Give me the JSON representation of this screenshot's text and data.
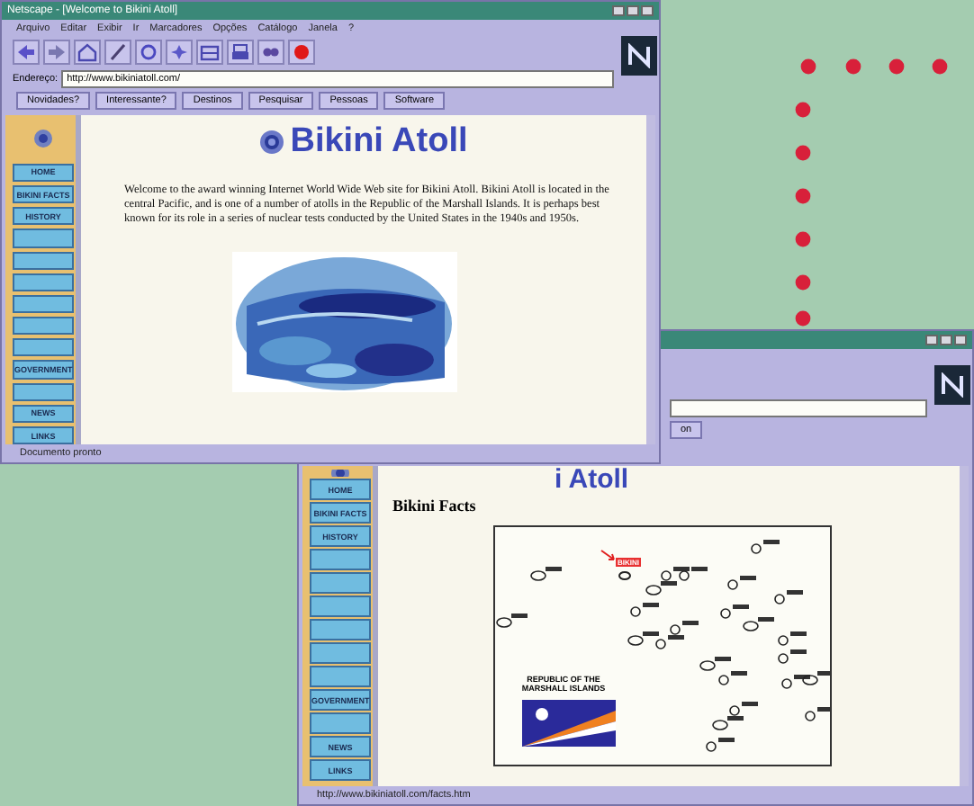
{
  "front_window": {
    "title": "Netscape - [Welcome to Bikini Atoll]",
    "menu": [
      "Arquivo",
      "Editar",
      "Exibir",
      "Ir",
      "Marcadores",
      "Opções",
      "Catálogo",
      "Janela",
      "?"
    ],
    "toolbar_buttons": [
      {
        "kind": "back"
      },
      {
        "kind": "forward"
      },
      {
        "kind": "home"
      },
      {
        "kind": "edit"
      },
      {
        "kind": "reload"
      },
      {
        "kind": "images"
      },
      {
        "kind": "open"
      },
      {
        "kind": "print"
      },
      {
        "kind": "find"
      },
      {
        "kind": "stop"
      }
    ],
    "address_label": "Endereço:",
    "address": "http://www.bikiniatoll.com/",
    "directory_buttons": [
      "Novidades?",
      "Interessante?",
      "Destinos",
      "Pesquisar",
      "Pessoas",
      "Software"
    ],
    "sidebar": [
      {
        "kind": "labeled",
        "label": "HOME"
      },
      {
        "kind": "labeled",
        "label": "BIKINI FACTS"
      },
      {
        "kind": "labeled",
        "label": "HISTORY"
      },
      {
        "kind": "unlabeled"
      },
      {
        "kind": "unlabeled"
      },
      {
        "kind": "unlabeled"
      },
      {
        "kind": "unlabeled"
      },
      {
        "kind": "unlabeled"
      },
      {
        "kind": "unlabeled"
      },
      {
        "kind": "labeled",
        "label": "GOVERNMENT"
      },
      {
        "kind": "unlabeled"
      },
      {
        "kind": "labeled",
        "label": "NEWS"
      },
      {
        "kind": "labeled",
        "label": "LINKS"
      }
    ],
    "heading": "Bikini Atoll",
    "intro": "Welcome to the award winning Internet World Wide Web site for Bikini Atoll. Bikini Atoll is located in the central Pacific, and is one of a number of atolls in the Republic of the Marshall Islands. It is perhaps best known for its role in a series of nuclear tests conducted by the United States in the 1940s and 1950s.",
    "photo": {
      "kind": "picture"
    },
    "status": "Documento pronto"
  },
  "back_window": {
    "directory_buttons": [
      "on"
    ],
    "sidebar": [
      {
        "kind": "labeled",
        "label": "HOME"
      },
      {
        "kind": "labeled",
        "label": "BIKINI FACTS"
      },
      {
        "kind": "labeled",
        "label": "HISTORY"
      },
      {
        "kind": "unlabeled"
      },
      {
        "kind": "unlabeled"
      },
      {
        "kind": "unlabeled"
      },
      {
        "kind": "unlabeled"
      },
      {
        "kind": "unlabeled"
      },
      {
        "kind": "unlabeled"
      },
      {
        "kind": "labeled",
        "label": "GOVERNMENT"
      },
      {
        "kind": "unlabeled"
      },
      {
        "kind": "labeled",
        "label": "NEWS"
      },
      {
        "kind": "labeled",
        "label": "LINKS"
      }
    ],
    "heading": "i Atoll",
    "subheading": "Bikini Facts",
    "map": {
      "caption": "REPUBLIC OF THE MARSHALL ISLANDS",
      "highlight_label": "BIKINI"
    },
    "status": "http://www.bikiniatoll.com/facts.htm"
  }
}
